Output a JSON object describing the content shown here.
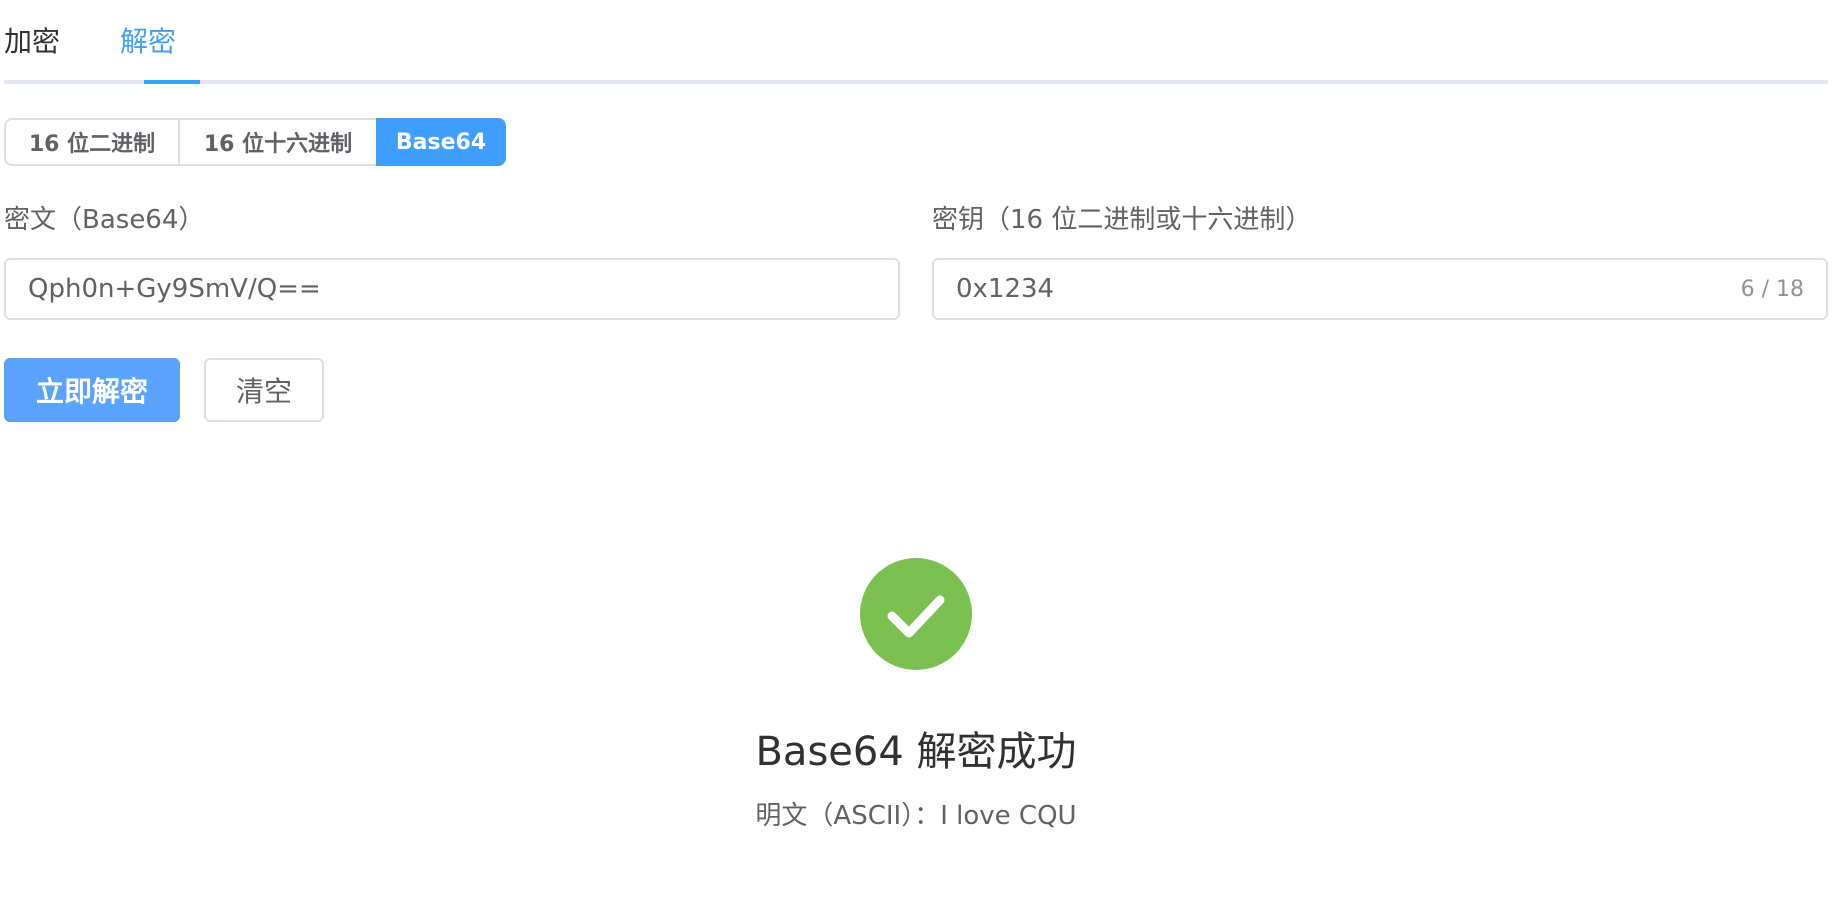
{
  "tabs": [
    {
      "label": "加密",
      "active": false
    },
    {
      "label": "解密",
      "active": true
    }
  ],
  "format": {
    "options": [
      "16 位二进制",
      "16 位十六进制",
      "Base64"
    ],
    "selected": "Base64"
  },
  "ciphertext": {
    "label": "密文（Base64）",
    "value": "Qph0n+Gy9SmV/Q=="
  },
  "key": {
    "label": "密钥（16 位二进制或十六进制）",
    "value": "0x1234",
    "counter": "6 / 18"
  },
  "actions": {
    "decrypt_label": "立即解密",
    "clear_label": "清空"
  },
  "result": {
    "icon": "check-circle-icon",
    "title": "Base64 解密成功",
    "subtitle": "明文（ASCII）：I love CQU"
  },
  "colors": {
    "primary": "#409eff",
    "success": "#7bc051",
    "border": "#dcdfe6"
  }
}
